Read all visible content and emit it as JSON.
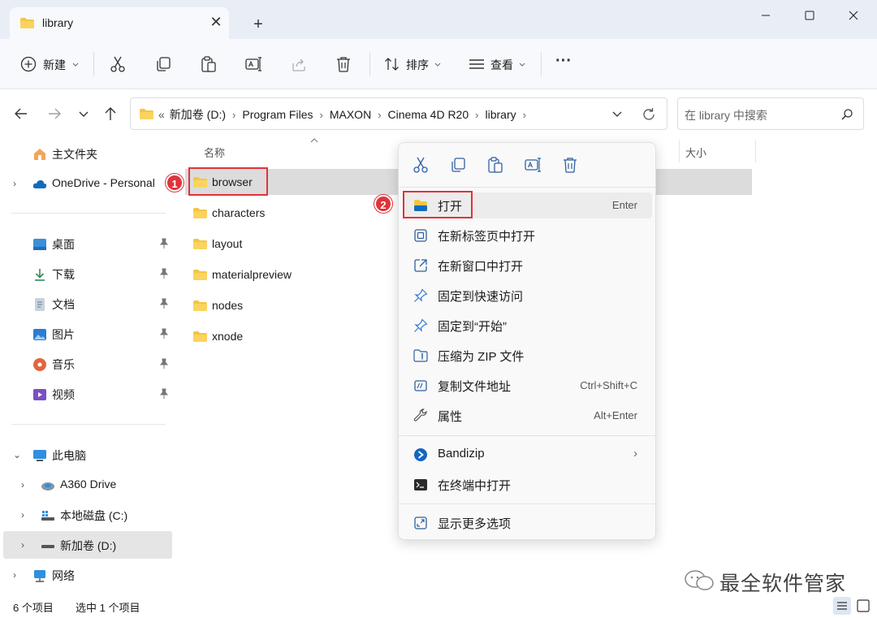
{
  "window": {
    "tab_title": "library",
    "newtab_glyph": "+",
    "close_glyph": "✕"
  },
  "toolbar": {
    "new_label": "新建",
    "sort_label": "排序",
    "view_label": "查看",
    "more_glyph": "···",
    "icons": [
      "cut-icon",
      "copy-icon",
      "paste-icon",
      "rename-icon",
      "share-icon",
      "delete-icon"
    ]
  },
  "address": {
    "overflow": "«",
    "crumbs": [
      "新加卷 (D:)",
      "Program Files",
      "MAXON",
      "Cinema 4D R20",
      "library"
    ],
    "search_placeholder": "在 library 中搜索"
  },
  "sidebar": {
    "top_items": [
      {
        "label": "主文件夹",
        "icon": "home-icon"
      },
      {
        "label": "OneDrive - Personal",
        "icon": "onedrive-icon"
      }
    ],
    "quick_access": [
      {
        "label": "桌面",
        "icon": "desktop-icon"
      },
      {
        "label": "下载",
        "icon": "download-icon"
      },
      {
        "label": "文档",
        "icon": "documents-icon"
      },
      {
        "label": "图片",
        "icon": "pictures-icon"
      },
      {
        "label": "音乐",
        "icon": "music-icon"
      },
      {
        "label": "视频",
        "icon": "videos-icon"
      }
    ],
    "this_pc": {
      "label": "此电脑",
      "icon": "pc-icon"
    },
    "drives": [
      {
        "label": "A360 Drive",
        "icon": "a360-icon"
      },
      {
        "label": "本地磁盘 (C:)",
        "icon": "drive-icon"
      },
      {
        "label": "新加卷 (D:)",
        "icon": "drive-icon"
      }
    ],
    "network": {
      "label": "网络",
      "icon": "network-icon"
    }
  },
  "filelist": {
    "col_name": "名称",
    "col_size": "大小",
    "files": [
      "browser",
      "characters",
      "layout",
      "materialpreview",
      "nodes",
      "xnode"
    ],
    "selected": "browser"
  },
  "context_menu": {
    "top_icons": [
      "cut-icon",
      "copy-icon",
      "paste-icon",
      "rename-icon",
      "delete-icon"
    ],
    "items": [
      {
        "label": "打开",
        "shortcut": "Enter",
        "icon": "folder-open-icon"
      },
      {
        "label": "在新标签页中打开",
        "shortcut": "",
        "icon": "new-tab-icon"
      },
      {
        "label": "在新窗口中打开",
        "shortcut": "",
        "icon": "new-window-icon"
      },
      {
        "label": "固定到快速访问",
        "shortcut": "",
        "icon": "pin-icon"
      },
      {
        "label": "固定到“开始”",
        "shortcut": "",
        "icon": "pin-icon"
      },
      {
        "label": "压缩为 ZIP 文件",
        "shortcut": "",
        "icon": "zip-icon"
      },
      {
        "label": "复制文件地址",
        "shortcut": "Ctrl+Shift+C",
        "icon": "copy-path-icon"
      },
      {
        "label": "属性",
        "shortcut": "Alt+Enter",
        "icon": "properties-icon"
      }
    ],
    "bandizip": {
      "label": "Bandizip",
      "icon": "bandizip-icon"
    },
    "terminal": {
      "label": "在终端中打开",
      "icon": "terminal-icon"
    },
    "more": {
      "label": "显示更多选项",
      "icon": "more-options-icon"
    }
  },
  "annotations": {
    "badge1": "1",
    "badge2": "2"
  },
  "status": {
    "count": "6 个项目",
    "selected": "选中 1 个项目"
  },
  "watermark": {
    "text": "最全软件管家"
  },
  "colors": {
    "accent": "#0067c0",
    "folder": "#f5c542",
    "annotation_red": "#e0333a"
  }
}
